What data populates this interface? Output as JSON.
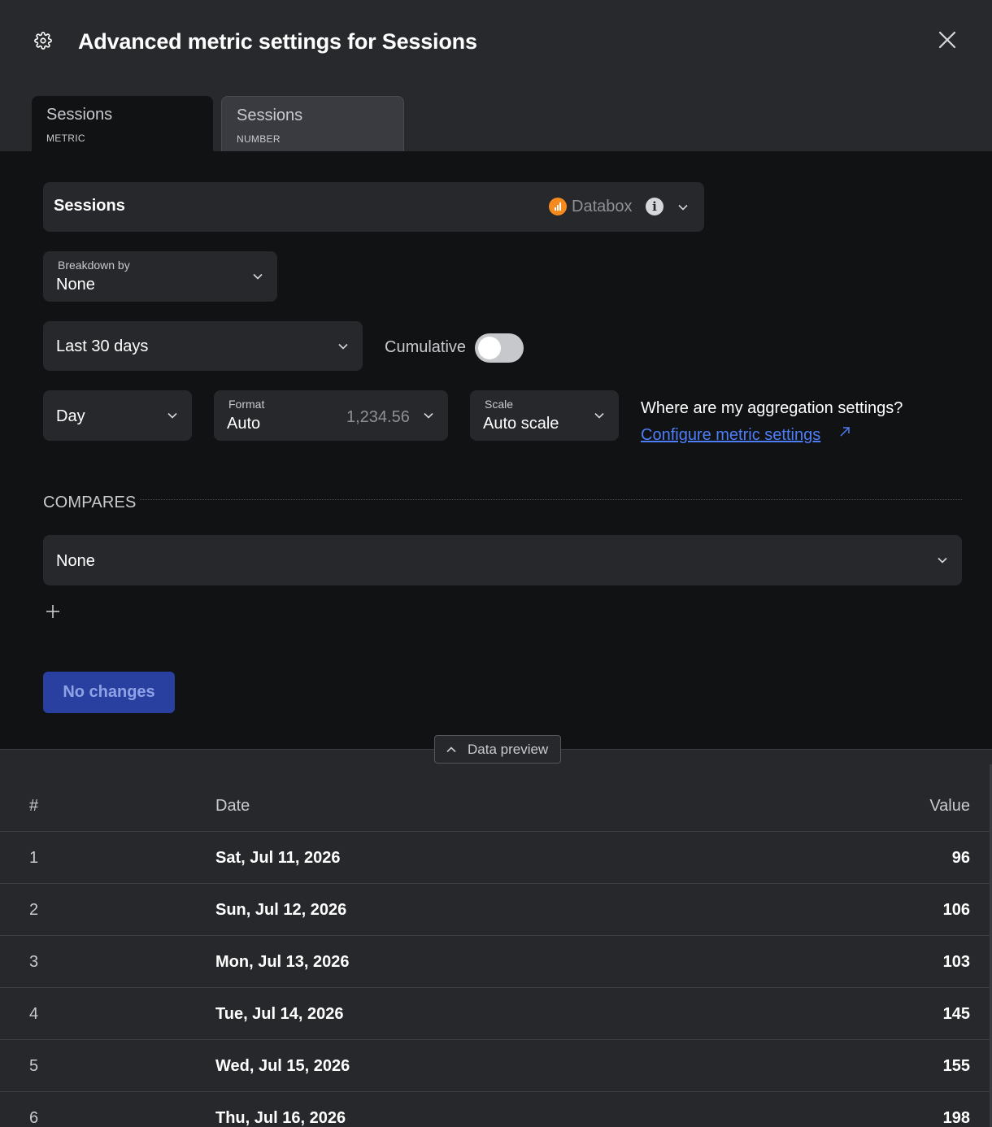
{
  "header": {
    "title": "Advanced metric settings for Sessions",
    "tabs": [
      {
        "label": "Sessions",
        "sublabel": "METRIC"
      },
      {
        "label": "Sessions",
        "sublabel": "NUMBER"
      }
    ]
  },
  "metric": {
    "name": "Sessions",
    "source": "Databox",
    "source_color": "#f58a1f"
  },
  "breakdown": {
    "label": "Breakdown by",
    "value": "None"
  },
  "date_range": {
    "value": "Last 30 days"
  },
  "cumulative": {
    "label": "Cumulative",
    "enabled": false
  },
  "granularity": {
    "value": "Day"
  },
  "format": {
    "label": "Format",
    "value": "Auto",
    "example": "1,234.56"
  },
  "scale": {
    "label": "Scale",
    "value": "Auto scale"
  },
  "aggregation": {
    "question": "Where are my aggregation settings?",
    "link": "Configure metric settings"
  },
  "compares": {
    "heading": "COMPARES",
    "value": "None"
  },
  "save_button": {
    "label": "No changes"
  },
  "data_preview": {
    "label": "Data preview"
  },
  "table": {
    "headers": {
      "num": "#",
      "date": "Date",
      "value": "Value"
    },
    "rows": [
      {
        "num": "1",
        "date": "Sat, Jul 11, 2026",
        "value": "96"
      },
      {
        "num": "2",
        "date": "Sun, Jul 12, 2026",
        "value": "106"
      },
      {
        "num": "3",
        "date": "Mon, Jul 13, 2026",
        "value": "103"
      },
      {
        "num": "4",
        "date": "Tue, Jul 14, 2026",
        "value": "145"
      },
      {
        "num": "5",
        "date": "Wed, Jul 15, 2026",
        "value": "155"
      },
      {
        "num": "6",
        "date": "Thu, Jul 16, 2026",
        "value": "198"
      }
    ]
  },
  "colors": {
    "accent_link": "#4d7ef7",
    "primary_button": "#2940a0",
    "background_dark": "#111214",
    "panel": "#27282c"
  }
}
